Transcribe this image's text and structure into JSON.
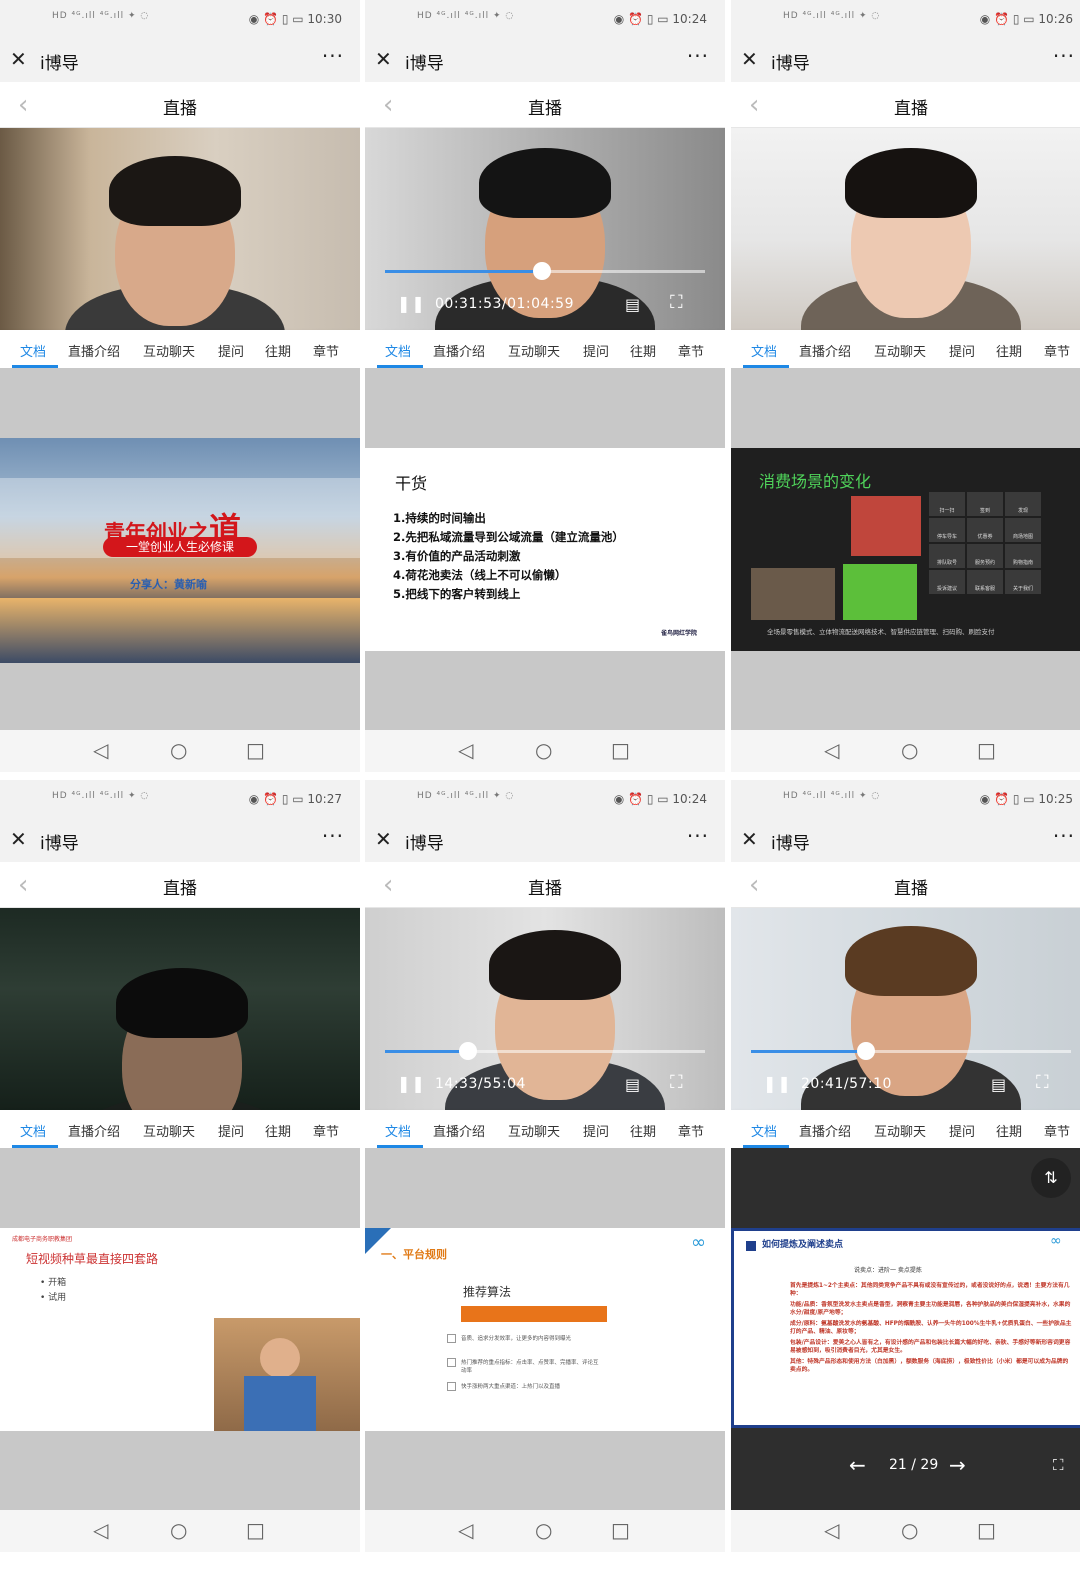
{
  "common": {
    "app_name": "i博导",
    "page_title": "直播",
    "close_glyph": "✕",
    "more_glyph": "···",
    "back_glyph": "‹",
    "signal_text": "HD ⁴ᴳ.ıll ⁴ᴳ.ıll ✦ ◌",
    "status_icons": "◉ ⏰ ▯ ▭",
    "tabs": [
      "文档",
      "直播介绍",
      "互动聊天",
      "提问",
      "往期",
      "章节"
    ],
    "nav_back": "◁",
    "nav_home": "○",
    "nav_recent": "□",
    "pause_glyph": "❚❚",
    "danmu_glyph": "▤",
    "fullscreen_glyph": "⛶"
  },
  "phones": [
    {
      "time": "10:30",
      "slide": {
        "title_main": "青年创业之",
        "title_big": "道",
        "subtitle": "一堂创业人生必修课",
        "speaker": "分享人：黄新喻"
      }
    },
    {
      "time": "10:24",
      "player": {
        "time": "00:31:53/01:04:59",
        "progress": 0.49
      },
      "slide": {
        "heading": "干货",
        "items": [
          "1.持续的时间输出",
          "2.先把私域流量导到公域流量（建立流量池）",
          "3.有价值的产品活动刺激",
          "4.荷花池卖法（线上不可以偷懒）",
          "5.把线下的客户转到线上"
        ],
        "logo": "雀鸟网红学院"
      }
    },
    {
      "time": "10:26",
      "slide": {
        "heading": "消费场景的变化",
        "grid": [
          "扫一扫",
          "签到",
          "发现",
          "停车导车",
          "优惠券",
          "商场地图",
          "排队取号",
          "服务预约",
          "购物指南",
          "投诉建议",
          "联系客服",
          "关于我们"
        ],
        "caption": "全场景零售模式、立体物流配送网络技术、智慧供应链管理、扫码购、刷脸支付"
      }
    },
    {
      "time": "10:27",
      "slide": {
        "org": "成都电子商务职教集团",
        "heading": "短视频种草最直接四套路",
        "bullets": [
          "• 开箱",
          "• 试用"
        ]
      }
    },
    {
      "time": "10:24",
      "player": {
        "time": "14:33/55:04",
        "progress": 0.26
      },
      "slide": {
        "section": "一、平台规则",
        "heading": "推荐算法",
        "rules": [
          "音质、追求分发效率，让更多的内容得到曝光",
          "热门推荐的重点指标：点击率、点赞率、完播率、评论互动率",
          "快手涨粉两大重点渠道：上热门以及直播"
        ]
      }
    },
    {
      "time": "10:25",
      "player": {
        "time": "20:41/57:10",
        "progress": 0.36
      },
      "slide": {
        "heading": "如何提炼及阐述卖点",
        "sub": "说卖点：进阶一 卖点提炼",
        "paras": [
          "首先是提炼1~2个主卖点：其他同类竞争产品不具有或没有宣传过的，或者没说好的点，说透！主要方法有几种：",
          "功能/品质：香氛型洗发水主卖点是香型，洞察青主要主功能是润唇，各种护肤品的美白保湿提亮补水，水果的水分/甜度/原产地等；",
          "成分/原料：氨基酸洗发水的氨基酸、HFP的烟酰胺、认养一头牛的100%生牛乳+优质乳蛋白、一些护肤品主打的产品、精油、原妆等；",
          "包装/产品设计：爱美之心人皆有之，有设计感的产品和包装比长篇大幅的好吃、亲肤、手感好等新形容词更容易被感知到，吸引消费者目光，尤其是女生。",
          "其他：特殊产品形态和使用方法（白加黑），额数服务（海底捞），极致性价比（小米）都是可以成为品牌的卖点的。"
        ],
        "page": "21 / 29"
      }
    }
  ]
}
